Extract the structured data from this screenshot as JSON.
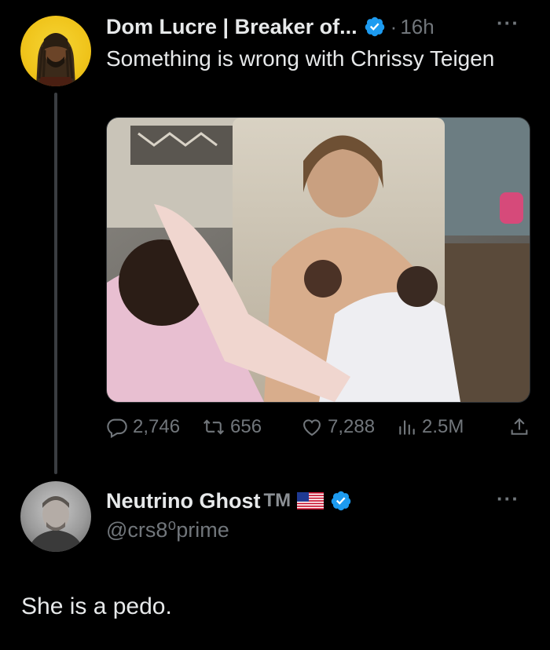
{
  "tweet": {
    "author": {
      "display_name": "Dom Lucre | Breaker of...",
      "verified": true,
      "separator": "·",
      "time": "16h",
      "avatar_icon": "avatar-dreadlocks"
    },
    "text": "Something is wrong with Chrissy Teigen",
    "media_description_icon": "photo-image",
    "actions": {
      "replies": "2,746",
      "reposts": "656",
      "likes": "7,288",
      "views": "2.5M"
    }
  },
  "reply": {
    "author": {
      "display_name": "Neutrino Ghost",
      "tm": "TM",
      "flag_icon": "us-flag-icon",
      "verified": true,
      "handle": "@crs8⁰prime",
      "avatar_icon": "avatar-man"
    },
    "text": "She is a pedo."
  },
  "colors": {
    "background": "#000000",
    "text": "#e7e9ea",
    "muted": "#71767b",
    "verified": "#1d9bf0",
    "thread_line": "#3a3d41"
  }
}
